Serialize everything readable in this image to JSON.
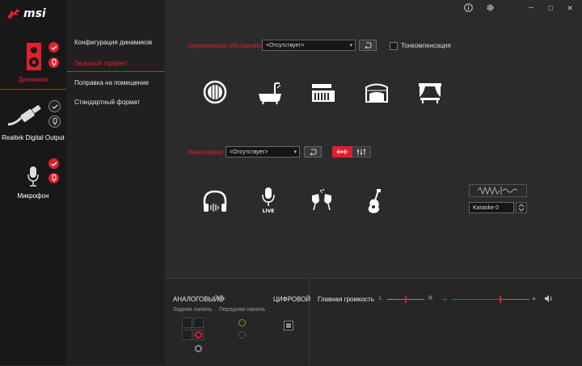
{
  "app": {
    "logo_text": "msi"
  },
  "window": {
    "info_icon": "info-icon",
    "settings_icon": "gear-icon",
    "minimize": "–",
    "maximize": "□",
    "close": "✕"
  },
  "devices": [
    {
      "label": "Динамики",
      "active": true
    },
    {
      "label": "Realtek Digital Output",
      "active": false
    },
    {
      "label": "Микрофон",
      "active": false
    }
  ],
  "menu": [
    {
      "label": "Конфигурация динамиков"
    },
    {
      "label": "Звуковой эффект"
    },
    {
      "label": "Поправка на помещение"
    },
    {
      "label": "Стандартный формат"
    }
  ],
  "environment": {
    "label": "Окружающая обстановка",
    "select_value": "<Отсутствует>",
    "loudness_label": "Тонкомпенсация"
  },
  "equalizer": {
    "label": "Эквалайзер",
    "select_value": "<Отсутствует>"
  },
  "karaoke": {
    "value": "Karaoke 0"
  },
  "bottom": {
    "analog_label": "АНАЛОГОВЫЙ",
    "digital_label": "ЦИФРОВОЙ",
    "rear_panel": "Задняя панель",
    "front_panel": "Передняя панель",
    "master_volume": "Главная громкость",
    "balance_left": "L",
    "balance_right": "R",
    "vol_minus": "–",
    "vol_plus": "+",
    "balance_level": 0.5,
    "volume_level": 0.62
  },
  "colors": {
    "accent": "#e0202e",
    "bg": "#2b2b2b"
  }
}
